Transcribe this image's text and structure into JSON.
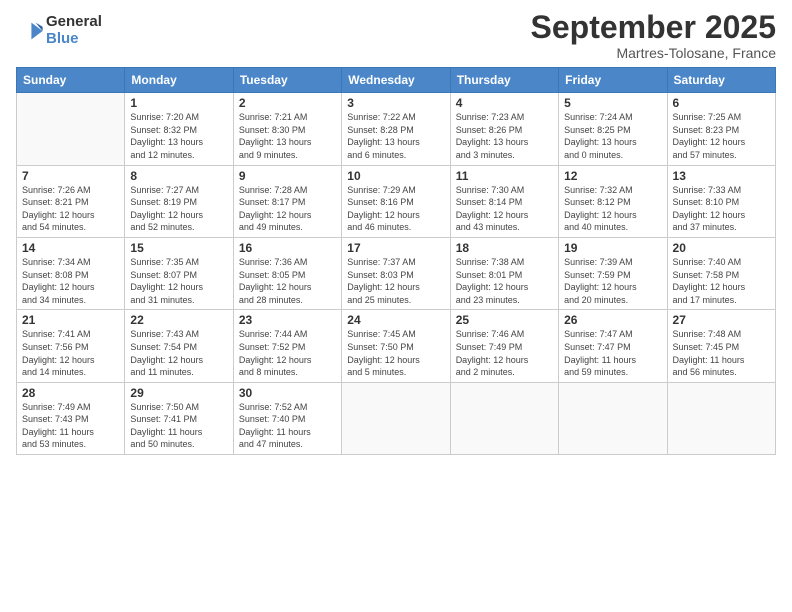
{
  "logo": {
    "line1": "General",
    "line2": "Blue"
  },
  "title": "September 2025",
  "subtitle": "Martres-Tolosane, France",
  "weekdays": [
    "Sunday",
    "Monday",
    "Tuesday",
    "Wednesday",
    "Thursday",
    "Friday",
    "Saturday"
  ],
  "weeks": [
    [
      {
        "day": "",
        "info": ""
      },
      {
        "day": "1",
        "info": "Sunrise: 7:20 AM\nSunset: 8:32 PM\nDaylight: 13 hours\nand 12 minutes."
      },
      {
        "day": "2",
        "info": "Sunrise: 7:21 AM\nSunset: 8:30 PM\nDaylight: 13 hours\nand 9 minutes."
      },
      {
        "day": "3",
        "info": "Sunrise: 7:22 AM\nSunset: 8:28 PM\nDaylight: 13 hours\nand 6 minutes."
      },
      {
        "day": "4",
        "info": "Sunrise: 7:23 AM\nSunset: 8:26 PM\nDaylight: 13 hours\nand 3 minutes."
      },
      {
        "day": "5",
        "info": "Sunrise: 7:24 AM\nSunset: 8:25 PM\nDaylight: 13 hours\nand 0 minutes."
      },
      {
        "day": "6",
        "info": "Sunrise: 7:25 AM\nSunset: 8:23 PM\nDaylight: 12 hours\nand 57 minutes."
      }
    ],
    [
      {
        "day": "7",
        "info": "Sunrise: 7:26 AM\nSunset: 8:21 PM\nDaylight: 12 hours\nand 54 minutes."
      },
      {
        "day": "8",
        "info": "Sunrise: 7:27 AM\nSunset: 8:19 PM\nDaylight: 12 hours\nand 52 minutes."
      },
      {
        "day": "9",
        "info": "Sunrise: 7:28 AM\nSunset: 8:17 PM\nDaylight: 12 hours\nand 49 minutes."
      },
      {
        "day": "10",
        "info": "Sunrise: 7:29 AM\nSunset: 8:16 PM\nDaylight: 12 hours\nand 46 minutes."
      },
      {
        "day": "11",
        "info": "Sunrise: 7:30 AM\nSunset: 8:14 PM\nDaylight: 12 hours\nand 43 minutes."
      },
      {
        "day": "12",
        "info": "Sunrise: 7:32 AM\nSunset: 8:12 PM\nDaylight: 12 hours\nand 40 minutes."
      },
      {
        "day": "13",
        "info": "Sunrise: 7:33 AM\nSunset: 8:10 PM\nDaylight: 12 hours\nand 37 minutes."
      }
    ],
    [
      {
        "day": "14",
        "info": "Sunrise: 7:34 AM\nSunset: 8:08 PM\nDaylight: 12 hours\nand 34 minutes."
      },
      {
        "day": "15",
        "info": "Sunrise: 7:35 AM\nSunset: 8:07 PM\nDaylight: 12 hours\nand 31 minutes."
      },
      {
        "day": "16",
        "info": "Sunrise: 7:36 AM\nSunset: 8:05 PM\nDaylight: 12 hours\nand 28 minutes."
      },
      {
        "day": "17",
        "info": "Sunrise: 7:37 AM\nSunset: 8:03 PM\nDaylight: 12 hours\nand 25 minutes."
      },
      {
        "day": "18",
        "info": "Sunrise: 7:38 AM\nSunset: 8:01 PM\nDaylight: 12 hours\nand 23 minutes."
      },
      {
        "day": "19",
        "info": "Sunrise: 7:39 AM\nSunset: 7:59 PM\nDaylight: 12 hours\nand 20 minutes."
      },
      {
        "day": "20",
        "info": "Sunrise: 7:40 AM\nSunset: 7:58 PM\nDaylight: 12 hours\nand 17 minutes."
      }
    ],
    [
      {
        "day": "21",
        "info": "Sunrise: 7:41 AM\nSunset: 7:56 PM\nDaylight: 12 hours\nand 14 minutes."
      },
      {
        "day": "22",
        "info": "Sunrise: 7:43 AM\nSunset: 7:54 PM\nDaylight: 12 hours\nand 11 minutes."
      },
      {
        "day": "23",
        "info": "Sunrise: 7:44 AM\nSunset: 7:52 PM\nDaylight: 12 hours\nand 8 minutes."
      },
      {
        "day": "24",
        "info": "Sunrise: 7:45 AM\nSunset: 7:50 PM\nDaylight: 12 hours\nand 5 minutes."
      },
      {
        "day": "25",
        "info": "Sunrise: 7:46 AM\nSunset: 7:49 PM\nDaylight: 12 hours\nand 2 minutes."
      },
      {
        "day": "26",
        "info": "Sunrise: 7:47 AM\nSunset: 7:47 PM\nDaylight: 11 hours\nand 59 minutes."
      },
      {
        "day": "27",
        "info": "Sunrise: 7:48 AM\nSunset: 7:45 PM\nDaylight: 11 hours\nand 56 minutes."
      }
    ],
    [
      {
        "day": "28",
        "info": "Sunrise: 7:49 AM\nSunset: 7:43 PM\nDaylight: 11 hours\nand 53 minutes."
      },
      {
        "day": "29",
        "info": "Sunrise: 7:50 AM\nSunset: 7:41 PM\nDaylight: 11 hours\nand 50 minutes."
      },
      {
        "day": "30",
        "info": "Sunrise: 7:52 AM\nSunset: 7:40 PM\nDaylight: 11 hours\nand 47 minutes."
      },
      {
        "day": "",
        "info": ""
      },
      {
        "day": "",
        "info": ""
      },
      {
        "day": "",
        "info": ""
      },
      {
        "day": "",
        "info": ""
      }
    ]
  ]
}
